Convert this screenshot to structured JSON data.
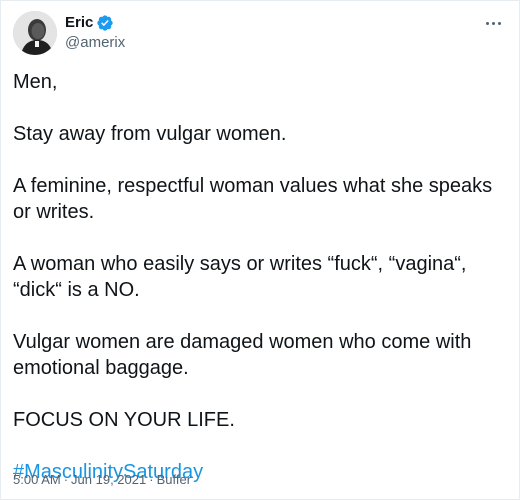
{
  "tweet": {
    "author": {
      "display_name": "Eric",
      "handle": "@amerix",
      "verified": true,
      "avatar_icon": "profile-photo"
    },
    "more_icon": "ellipsis-icon",
    "paragraphs": [
      "Men,",
      "Stay away from vulgar women.",
      "A feminine, respectful woman values what she speaks or writes.",
      "A woman who easily says or writes “fuck“, “vagina“, “dick“ is a NO.",
      "Vulgar women are damaged women who come with emotional baggage.",
      "FOCUS ON YOUR LIFE."
    ],
    "hashtag": "#MasculinitySaturday",
    "time": "5:00 AM",
    "date": "Jun 19, 2021",
    "source": "Buffer",
    "separator": "·"
  },
  "colors": {
    "hashtag": "#1b95e0",
    "verified": "#1d9bf0",
    "secondary_text": "#536471"
  }
}
